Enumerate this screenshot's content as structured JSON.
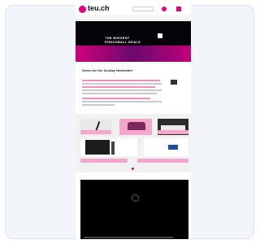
{
  "site": {
    "logo": "teu.ch",
    "account_label": ""
  },
  "nav": {
    "items": [
      "",
      "",
      "",
      "",
      "",
      "",
      "",
      ""
    ]
  },
  "hero": {
    "line1": "THE BIGGEST",
    "line2": "PUNCHBALL DEALS"
  },
  "article": {
    "title": "Seven for the Sunday Newsletter"
  },
  "colors": {
    "brand": "#e6007e",
    "hero_bg": "#07030a",
    "button": "#f4a6cc"
  },
  "video": {
    "state": "loading"
  }
}
